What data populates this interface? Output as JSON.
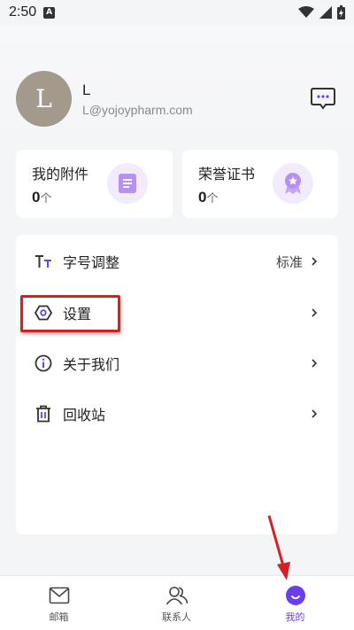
{
  "status_bar": {
    "time": "2:50",
    "notification_letter": "A"
  },
  "profile": {
    "avatar_letter": "L",
    "name": "L",
    "email": "L@yojoypharm.com"
  },
  "cards": [
    {
      "title": "我的附件",
      "count": "0",
      "unit": "个",
      "icon": "document-icon"
    },
    {
      "title": "荣誉证书",
      "count": "0",
      "unit": "个",
      "icon": "award-icon"
    }
  ],
  "menu": [
    {
      "label": "字号调整",
      "value": "标准",
      "icon": "font-size-icon"
    },
    {
      "label": "设置",
      "value": "",
      "icon": "settings-icon"
    },
    {
      "label": "关于我们",
      "value": "",
      "icon": "info-icon"
    },
    {
      "label": "回收站",
      "value": "",
      "icon": "trash-icon"
    }
  ],
  "tabs": [
    {
      "label": "邮箱",
      "icon": "mail-icon",
      "active": false
    },
    {
      "label": "联系人",
      "icon": "contacts-icon",
      "active": false
    },
    {
      "label": "我的",
      "icon": "profile-smile-icon",
      "active": true
    }
  ],
  "colors": {
    "accent": "#6a3df0",
    "accent_light": "#f1ebfd",
    "highlight": "#d32020"
  }
}
